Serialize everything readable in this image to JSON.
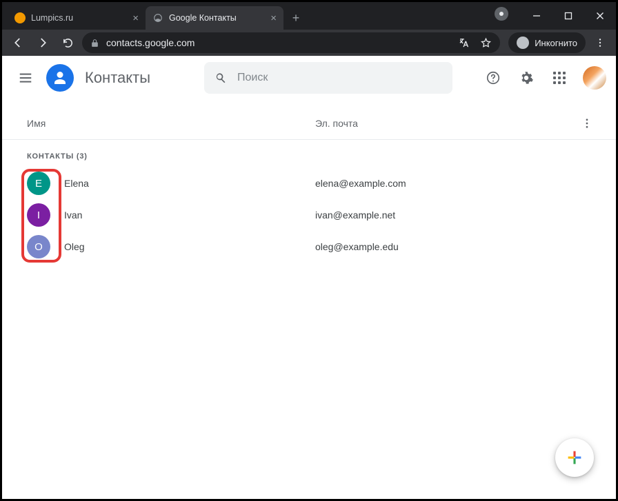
{
  "browser": {
    "tabs": [
      {
        "title": "Lumpics.ru",
        "active": false,
        "favicon_color": "#f29900"
      },
      {
        "title": "Google Контакты",
        "active": true,
        "favicon_color": "#9aa0a6"
      }
    ],
    "url": "contacts.google.com",
    "incognito_label": "Инкогнито"
  },
  "app": {
    "title": "Контакты",
    "search_placeholder": "Поиск",
    "columns": {
      "name": "Имя",
      "email": "Эл. почта"
    },
    "section_label": "КОНТАКТЫ (3)",
    "contacts": [
      {
        "initial": "E",
        "name": "Elena",
        "email": "elena@example.com",
        "color": "#009688"
      },
      {
        "initial": "I",
        "name": "Ivan",
        "email": "ivan@example.net",
        "color": "#7b1fa2"
      },
      {
        "initial": "O",
        "name": "Oleg",
        "email": "oleg@example.edu",
        "color": "#7986cb"
      }
    ]
  }
}
